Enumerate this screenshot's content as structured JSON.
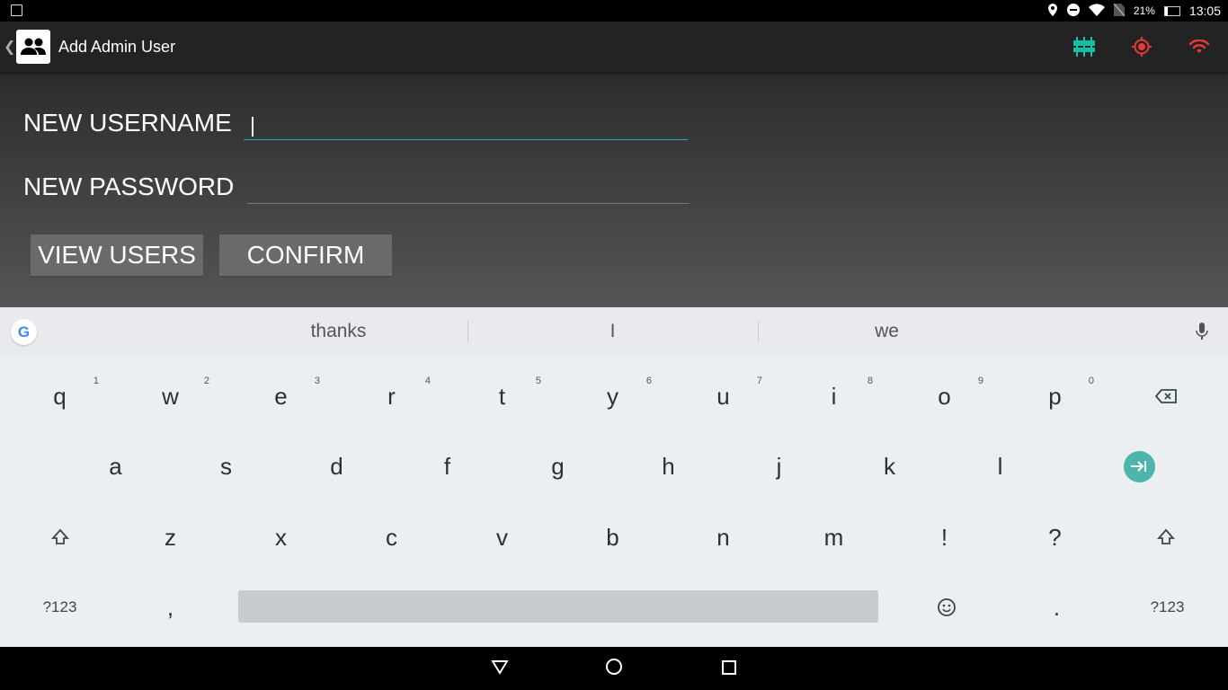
{
  "status_bar": {
    "battery": "21%",
    "time": "13:05",
    "battery_level": 0.21
  },
  "app_bar": {
    "title": "Add Admin User"
  },
  "form": {
    "username_label": "NEW USERNAME",
    "username_value": "",
    "password_label": "NEW PASSWORD",
    "password_value": ""
  },
  "buttons": {
    "view_users": "VIEW USERS",
    "confirm": "CONFIRM"
  },
  "keyboard": {
    "suggestions": [
      "thanks",
      "I",
      "we"
    ],
    "row1": [
      {
        "k": "q",
        "n": "1"
      },
      {
        "k": "w",
        "n": "2"
      },
      {
        "k": "e",
        "n": "3"
      },
      {
        "k": "r",
        "n": "4"
      },
      {
        "k": "t",
        "n": "5"
      },
      {
        "k": "y",
        "n": "6"
      },
      {
        "k": "u",
        "n": "7"
      },
      {
        "k": "i",
        "n": "8"
      },
      {
        "k": "o",
        "n": "9"
      },
      {
        "k": "p",
        "n": "0"
      }
    ],
    "row2": [
      "a",
      "s",
      "d",
      "f",
      "g",
      "h",
      "j",
      "k",
      "l"
    ],
    "row3": [
      "z",
      "x",
      "c",
      "v",
      "b",
      "n",
      "m",
      "!",
      "?"
    ],
    "symbols_label": "?123",
    "comma": ",",
    "period": "."
  },
  "colors": {
    "accent_teal": "#14c0a4",
    "alert_red": "#e53935",
    "enter_key": "#4db6ac"
  }
}
